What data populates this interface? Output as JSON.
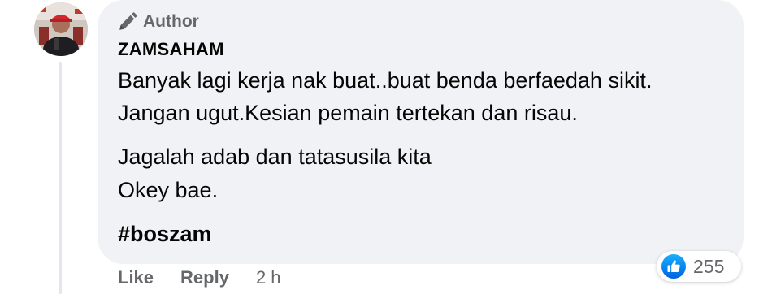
{
  "comment": {
    "badge": {
      "icon": "pencil-author-icon",
      "label": "Author"
    },
    "author_name": "ZAMSAHAM",
    "avatar_icon": "profile-photo-avatar",
    "lines": [
      "Banyak lagi kerja nak buat..buat benda berfaedah sikit.",
      "Jangan ugut.Kesian pemain tertekan dan risau.",
      "Jagalah adab dan tatasusila kita",
      "Okey bae."
    ],
    "hashtag": "#boszam",
    "actions": {
      "like_label": "Like",
      "reply_label": "Reply",
      "timestamp": "2 h"
    },
    "reactions": {
      "icon": "thumbs-up-icon",
      "count": "255",
      "color": "#1877f2"
    }
  },
  "colors": {
    "bubble": "#f0f2f5",
    "secondary_text": "#65676b",
    "primary_text": "#050505"
  }
}
